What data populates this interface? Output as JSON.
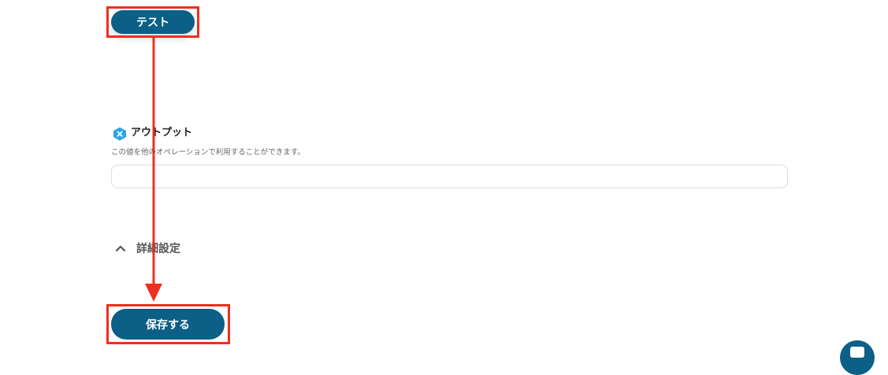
{
  "test_button": {
    "label": "テスト"
  },
  "output": {
    "title": "アウトプット",
    "description": "この値を他のオペレーションで利用することができます。",
    "value": ""
  },
  "advanced": {
    "label": "詳細設定",
    "expanded": true
  },
  "save_button": {
    "label": "保存する"
  },
  "colors": {
    "button": "#0c5f86",
    "highlight": "#ee2f20",
    "output_icon": "#2aa5e8"
  },
  "icons": {
    "output": "output-x-icon",
    "advanced": "chevron-up-icon",
    "fab": "chat-icon"
  }
}
